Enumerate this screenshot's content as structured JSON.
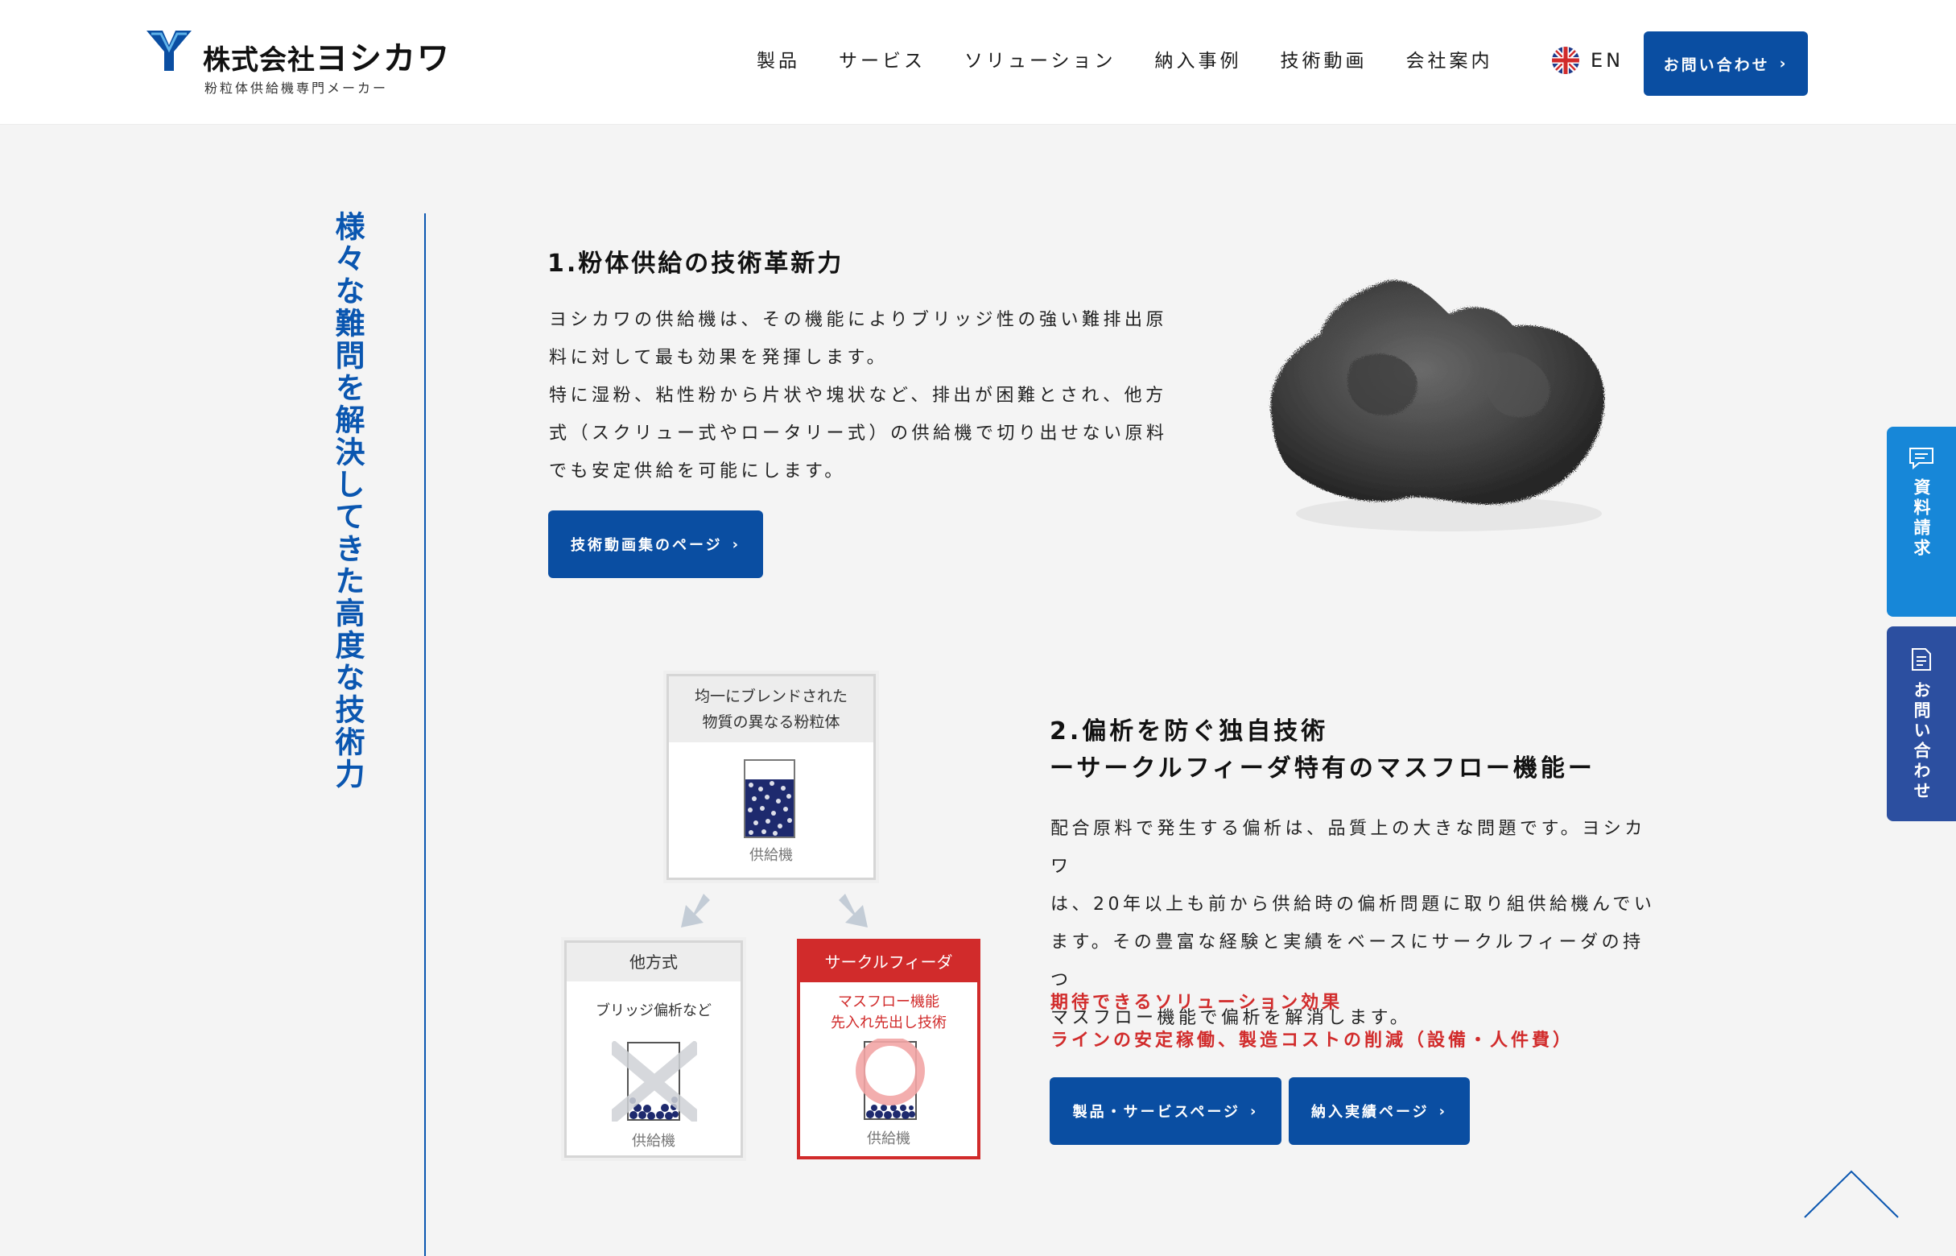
{
  "header": {
    "company_prefix": "株式会社",
    "company_name": "ヨシカワ",
    "tagline": "粉粒体供給機専門メーカー",
    "nav": [
      "製品",
      "サービス",
      "ソリューション",
      "納入事例",
      "技術動画",
      "会社案内"
    ],
    "lang_label": "EN",
    "contact_label": "お問い合わせ"
  },
  "side": {
    "title": "様々な難問を解決してきた高度な技術力"
  },
  "section1": {
    "heading": "1.粉体供給の技術革新力",
    "lines": [
      "ヨシカワの供給機は、その機能によりブリッジ性の強い難排出原",
      "料に対して最も効果を発揮します。",
      "特に湿粉、粘性粉から片状や塊状など、排出が困難とされ、他方",
      "式（スクリュー式やロータリー式）の供給機で切り出せない原料",
      "でも安定供給を可能にします。"
    ],
    "button": "技術動画集のページ"
  },
  "diagram": {
    "top_head": [
      "均一にブレンドされた",
      "物質の異なる粉粒体"
    ],
    "top_caption": "供給機",
    "left_head": "他方式",
    "left_sub": "ブリッジ偏析など",
    "left_caption": "供給機",
    "right_head": "サークルフィーダ",
    "right_sub": [
      "マスフロー機能",
      "先入れ先出し技術"
    ],
    "right_caption": "供給機",
    "colors": {
      "accent_red": "#d12b2b",
      "particle": "#1e2a6e"
    }
  },
  "section2": {
    "heading": [
      "2.偏析を防ぐ独自技術",
      "ーサークルフィーダ特有のマスフロー機能ー"
    ],
    "lines": [
      "配合原料で発生する偏析は、品質上の大きな問題です。ヨシカワ",
      "は、20年以上も前から供給時の偏析問題に取り組供給機んでい",
      "ます。その豊富な経験と実績をベースにサークルフィーダの持つ",
      "マスフロー機能で偏析を解消します。"
    ],
    "effects": [
      "期待できるソリューション効果",
      "ラインの安定稼働、製造コストの削減（設備・人件費）"
    ],
    "button_products": "製品・サービスページ",
    "button_cases": "納入実績ページ"
  },
  "float": {
    "doc_request": "資料請求",
    "contact": "お問い合わせ"
  },
  "colors": {
    "brand_blue": "#0a4ea2",
    "title_blue": "#0a56b0",
    "tab_light_blue": "#1787d8",
    "tab_dark_blue": "#2c4fa0"
  }
}
